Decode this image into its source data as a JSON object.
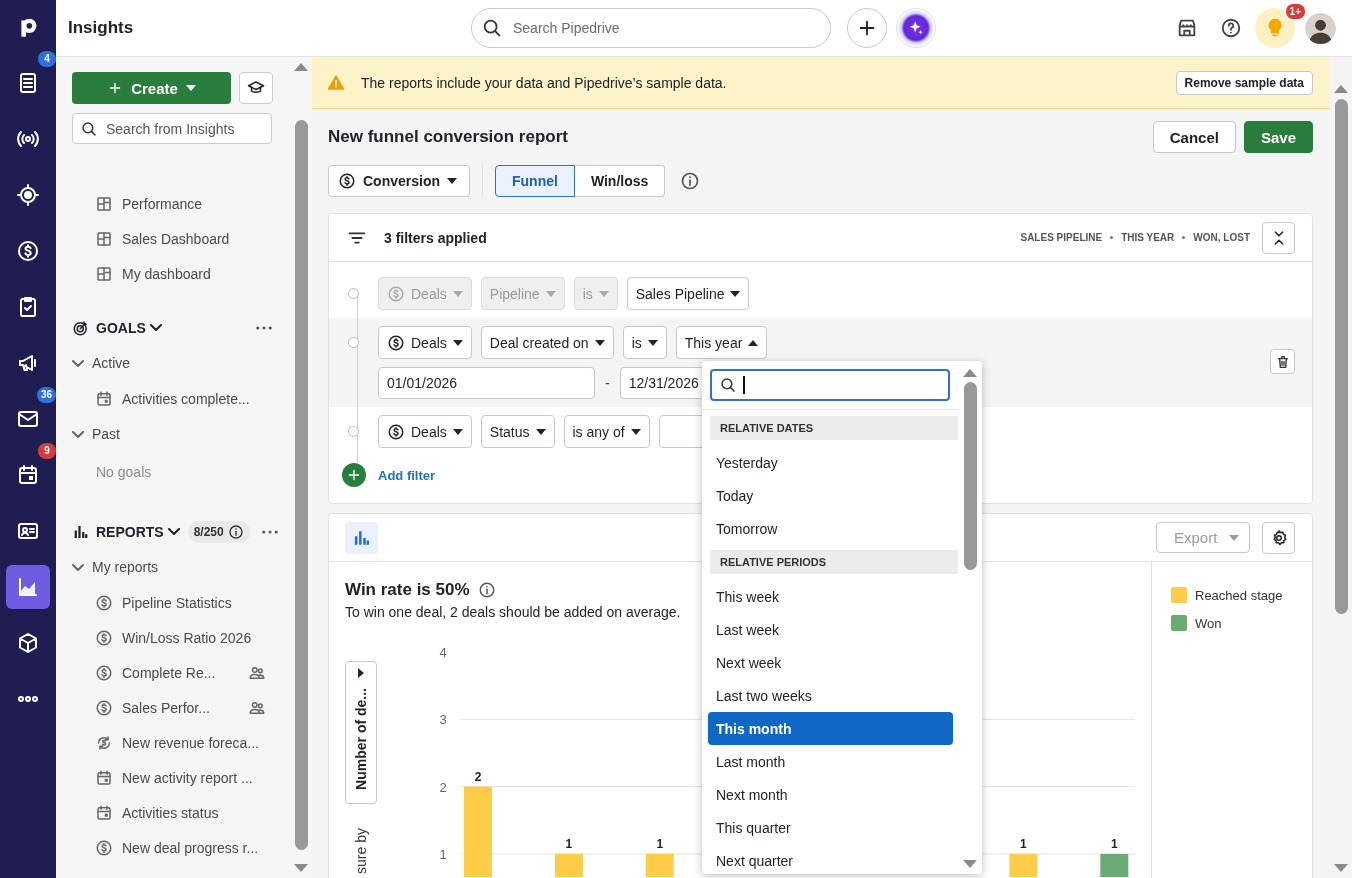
{
  "rail": {
    "items": [
      {
        "selected": false,
        "badge": "4",
        "color": "#2f6fe0"
      },
      {
        "selected": false
      },
      {
        "selected": false
      },
      {
        "selected": false
      },
      {
        "selected": false
      },
      {
        "selected": false
      },
      {
        "selected": false,
        "badge": "36",
        "color": "#2f6fe0"
      },
      {
        "selected": false,
        "badge": "9",
        "color": "#d93b3b"
      },
      {
        "selected": false
      },
      {
        "selected": true
      },
      {
        "selected": false
      },
      {
        "selected": false
      }
    ]
  },
  "header": {
    "title": "Insights",
    "search": {
      "placeholder": "Search Pipedrive"
    },
    "notification_badge": "1+"
  },
  "sidebar": {
    "create_button": "Create",
    "search": {
      "placeholder": "Search from Insights"
    },
    "dashboards": [
      "Performance",
      "Sales Dashboard",
      "My dashboard"
    ],
    "goals": {
      "title": "GOALS",
      "expanded": true,
      "groups": [
        {
          "label": "Active",
          "expanded": true,
          "children": [
            {
              "label": "Activities complete..."
            }
          ]
        },
        {
          "label": "Past",
          "expanded": true,
          "empty_text": "No goals"
        }
      ]
    },
    "reports": {
      "title": "REPORTS",
      "expanded": true,
      "count": "8/250",
      "groups": [
        {
          "label": "My reports",
          "expanded": true,
          "children": [
            {
              "label": "Pipeline Statistics",
              "kind": "deal",
              "shared": false
            },
            {
              "label": "Win/Loss Ratio 2026",
              "kind": "deal",
              "shared": false
            },
            {
              "label": "Complete Re...",
              "kind": "deal",
              "shared": true
            },
            {
              "label": "Sales Perfor...",
              "kind": "deal",
              "shared": true
            },
            {
              "label": "New revenue foreca...",
              "kind": "forecast",
              "shared": false
            },
            {
              "label": "New activity report ...",
              "kind": "activity",
              "shared": false
            },
            {
              "label": "Activities status",
              "kind": "activity",
              "shared": false
            },
            {
              "label": "New deal progress r...",
              "kind": "deal",
              "shared": false
            }
          ]
        }
      ]
    }
  },
  "banner": {
    "text": "The reports include your data and Pipedrive’s sample data.",
    "button": "Remove sample data"
  },
  "report": {
    "title": "New funnel conversion report",
    "cancel_button": "Cancel",
    "save_button": "Save",
    "type_select": "Conversion",
    "view_tabs": [
      {
        "label": "Funnel",
        "selected": true
      },
      {
        "label": "Win/loss",
        "selected": false
      }
    ]
  },
  "filters": {
    "summary": "3 filters applied",
    "tags": [
      "SALES PIPELINE",
      "THIS YEAR",
      "WON, LOST"
    ],
    "rows": [
      {
        "highlighted": false,
        "selects": [
          {
            "label": "Deals",
            "kind": "entity",
            "disabled": true
          },
          {
            "label": "Pipeline",
            "kind": "field",
            "disabled": true
          },
          {
            "label": "is",
            "kind": "field",
            "disabled": true
          },
          {
            "label": "Sales Pipeline",
            "kind": "field",
            "disabled": false
          }
        ]
      },
      {
        "highlighted": true,
        "selects": [
          {
            "label": "Deals",
            "kind": "entity",
            "disabled": false
          },
          {
            "label": "Deal created on",
            "kind": "field",
            "disabled": false
          },
          {
            "label": "is",
            "kind": "field",
            "disabled": false
          },
          {
            "label": "This year",
            "kind": "field",
            "disabled": false,
            "open": true
          }
        ],
        "dates": [
          "01/01/2026",
          "12/31/2026"
        ],
        "date_separator": "-"
      },
      {
        "highlighted": false,
        "selects": [
          {
            "label": "Deals",
            "kind": "entity",
            "disabled": false
          },
          {
            "label": "Status",
            "kind": "field",
            "disabled": false
          },
          {
            "label": "is any of",
            "kind": "field",
            "disabled": false
          },
          {
            "kind": "hidden"
          }
        ]
      }
    ],
    "add_filter": "Add filter"
  },
  "dropdown": {
    "search": {
      "focused": true
    },
    "sections": [
      {
        "title": "RELATIVE DATES",
        "options": [
          {
            "label": "Yesterday",
            "selected": false
          },
          {
            "label": "Today",
            "selected": false
          },
          {
            "label": "Tomorrow",
            "selected": false
          }
        ]
      },
      {
        "title": "RELATIVE PERIODS",
        "options": [
          {
            "label": "This week",
            "selected": false
          },
          {
            "label": "Last week",
            "selected": false
          },
          {
            "label": "Next week",
            "selected": false
          },
          {
            "label": "Last two weeks",
            "selected": false
          },
          {
            "label": "This month",
            "selected": true
          },
          {
            "label": "Last month",
            "selected": false
          },
          {
            "label": "Next month",
            "selected": false
          },
          {
            "label": "This quarter",
            "selected": false
          },
          {
            "label": "Next quarter",
            "selected": false
          }
        ]
      }
    ]
  },
  "chart": {
    "export_button": {
      "label": "Export",
      "disabled": true
    },
    "chart_type_selected": true,
    "headline": "Win rate is 50%",
    "subline": "To win one deal, 2 deals should be added on average.",
    "measure_button": "Number of de...",
    "axis_label": "sure by",
    "chart_data": {
      "type": "bar",
      "ylim": [
        0,
        4
      ],
      "yticks": [
        1,
        2,
        3,
        4
      ],
      "data_labels": true,
      "grid": true,
      "series": [
        {
          "name": "Reached stage",
          "color": "#ffcc47",
          "values": [
            2,
            1,
            1,
            null,
            null,
            null,
            1,
            null
          ]
        },
        {
          "name": "Won",
          "color": "#6aab73",
          "values": [
            null,
            null,
            null,
            null,
            null,
            null,
            null,
            1
          ]
        }
      ]
    }
  }
}
